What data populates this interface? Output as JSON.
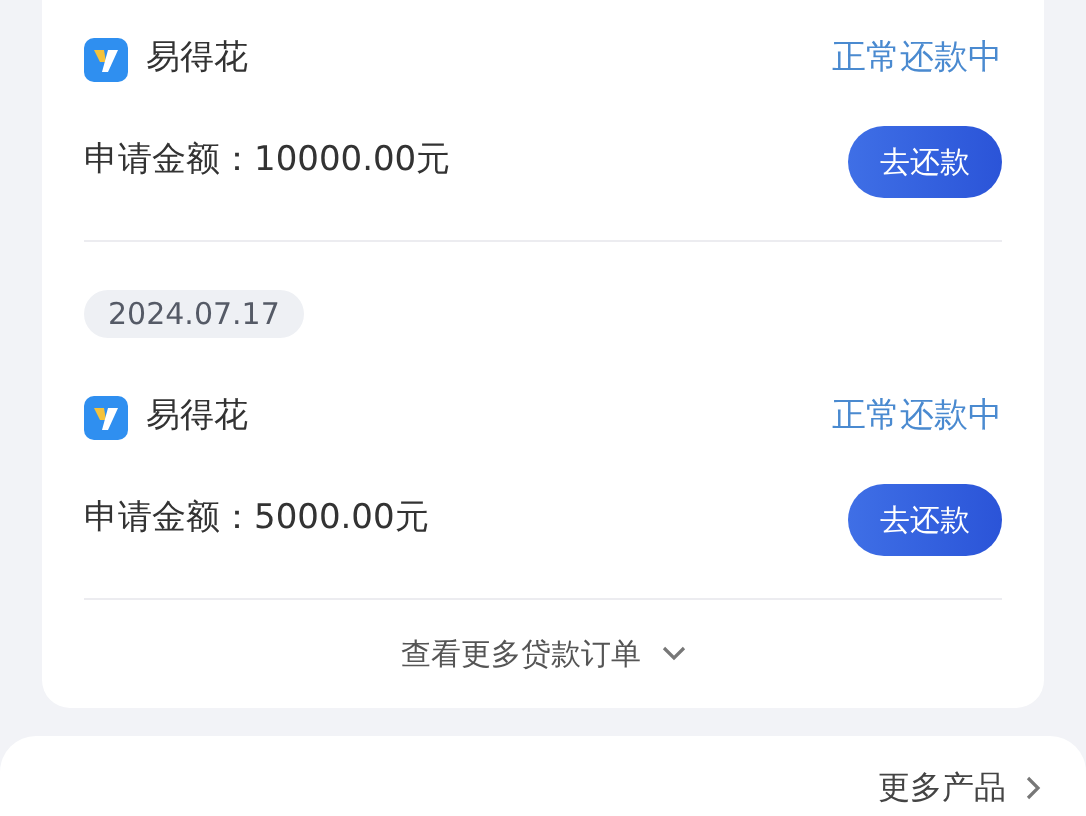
{
  "orders": [
    {
      "app_name": "易得花",
      "status": "正常还款中",
      "amount": "申请金额：10000.00元",
      "action": "去还款"
    },
    {
      "date": "2024.07.17",
      "app_name": "易得花",
      "status": "正常还款中",
      "amount": "申请金额：5000.00元",
      "action": "去还款"
    }
  ],
  "more_orders": "查看更多贷款订单",
  "more_products": "更多产品"
}
